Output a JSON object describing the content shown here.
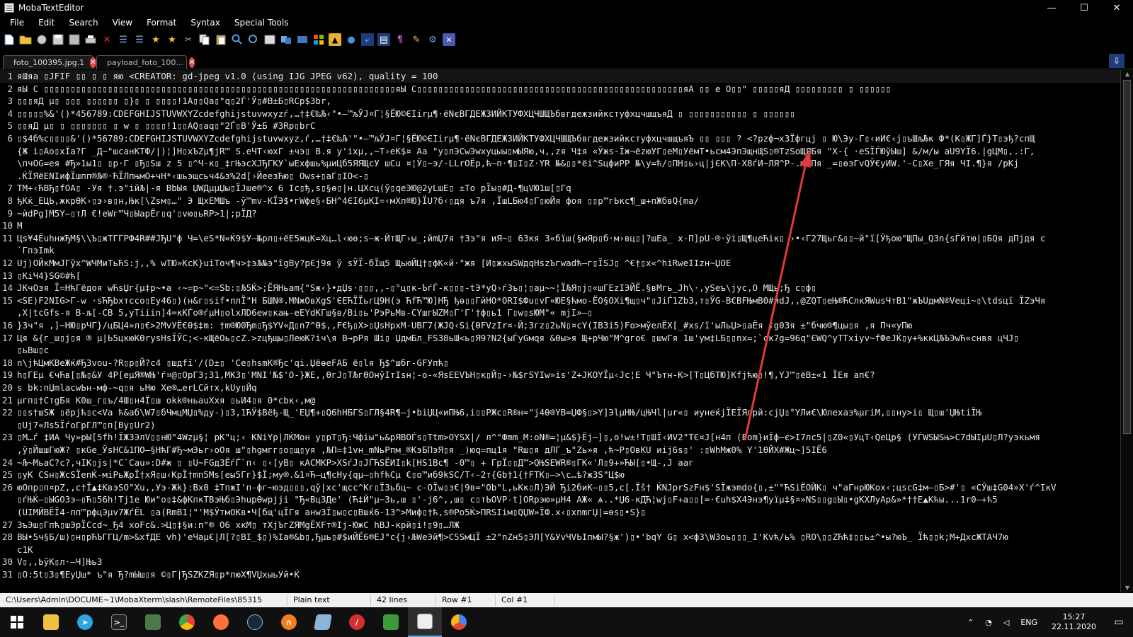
{
  "window": {
    "title": "MobaTextEditor",
    "minimize": "—",
    "maximize": "☐",
    "close": "✕"
  },
  "menu": [
    "File",
    "Edit",
    "Search",
    "View",
    "Format",
    "Syntax",
    "Special Tools"
  ],
  "toolbar": {
    "icons": [
      "new-file-icon",
      "open-folder-icon",
      "reload-icon",
      "save-icon",
      "save-all-icon",
      "print-icon",
      "close-file-icon",
      "indent-icon",
      "outdent-icon",
      "bookmark-icon",
      "bookmark-next-icon",
      "cut-icon",
      "copy-icon",
      "paste-icon",
      "search-icon",
      "replace-icon",
      "goto-icon",
      "compare-icon",
      "windows-icon",
      "windows-logo-icon",
      "linux-icon",
      "apple-icon",
      "wrap-icon",
      "highlight-icon",
      "pilcrow-icon",
      "pen-icon",
      "settings-icon",
      "close-x-icon"
    ]
  },
  "tabs": [
    {
      "label": "foto_100395.jpg.1",
      "active": true
    },
    {
      "label": "payload_foto_100...",
      "active": false
    }
  ],
  "tab_menu": "⇩",
  "editor": {
    "lines": [
      {
        "n": "1",
        "t": "яШяа ▯JFIF ▯▯  ▯ ▯  яю <CREATOR: gd-jpeg v1.0 (using IJG JPEG v62), quality = 100"
      },
      {
        "n": "2",
        "t": "яЫ C ▯▯▯▯▯▯▯▯▯▯▯▯▯▯▯▯▯▯▯▯▯▯▯▯▯▯▯▯▯▯▯▯▯▯▯▯▯▯▯▯▯▯▯▯▯▯▯▯▯▯▯▯▯▯▯▯▯▯▯▯▯▯▯▯▯▯яЫ C▯▯▯▯▯▯▯▯▯▯▯▯▯▯▯▯▯▯▯▯▯▯▯▯▯▯▯▯▯▯▯▯▯▯▯▯▯▯▯▯▯▯▯▯▯▯▯▯▯▯яА ▯▯ е О▯▯\"  ▯▯▯▯▯яД    ▯▯▯▯▯▯▯▯▯         ▯ ▯▯▯▯▯▯"
      },
      {
        "n": "3",
        "t": "▯▯▯яД µ▯  ▯▯▯ ▯▯▯▯▯▯  ▯}▯ ▯ ▯▯▯▯!1А▯▯Qа▯\"q▯2Ѓ'Ў▯#В±Б▯RСр$3br,"
      },
      {
        "n": "4",
        "t": "▯▯▯▯▯%&'()*456789:CDEFGHIJSTUVWXYZcdefghijstuvwxyzѓ,…†‡€‰Љ‹\"•—™љЎЈ¤Г¦§ЁЮ©ЄІirµ¶·ёNєВГДЕЖЗИЙКТУФХЦЧШЩЪбвгдежзийкстуфхцчшщъяД  ▯ ▯▯▯▯▯▯▯▯▯▯▯       ▯ ▯▯▯▯▯▯"
      },
      {
        "n": "5",
        "t": "▯▯яД µ▯  ▯ ▯▯▯▯▯▯▯  ▯ w ▯ ▯▯▯▯!1▯▯AQ▯aq▯\"2Ѓ▯В'Ў±Б #3Rр▯brС"
      },
      {
        "n": "6",
        "t": "▯$4б%c▯▯▯▯&'()*56789:CDEFGHIJSTUVWXYZcdefghijstuvwxyz,ѓ,…†‡€‰Љ'\"•—™љЎЈ¤Г¦§ЁЮ©ЄІirµ¶·ёNєВГДЕЖЗИЙКТУФХЦЧШЩЪбвгдежзийкстуфхцчшщъяЪ ▯▯   ▯▯▯ ? <?pzф¬хЗЇфгцj ▯ Ю\\Эу-Г▯‹иИ€‹ј▯ъШљЉк Ф*(К▯ЖГ]Ѓ}Т▯эђ?спЩ"
      },
      {
        "n": "",
        "t": "{Ж і▯Ао▯хЇа?Г _Д~\"шсанКТФ/|)¦]Н▯хЪZµ¶јR™ S.еЧТ‹юхГ ±чэ▯ В.я у'ixµ,,~Т›еК$¤ Аа \"у▯лЭСwЭwхуцыы▯мЫЯю,ч,,zя Ч‡я «Ўжѕ-Їж¬ёzюУГ▯еМ▯УёмТ•ьсм4ЭпЭщнЩЅ▯®ТzЅоЩЯБя \"Х-{ ·еЅЇЃЮўЫш] &/м/ы aU9YЇ6.|gЦМ▯,.:Г,"
      },
      {
        "n": "",
        "t": "\\пчОG=ея #Ђ»1ы1▯ ▯р·Г ▯Ђ▯Sш z 5 ▯^Ч-к▯_‡гЊэсХЈЂГКУ`ыЕхфшь%µиЦб5ЯЯЩсУ шСu ¤¦Ў▯~э/-LLrОЁр,ћ–п·¶▯І▯Z·YR №&▯▯*ёі^SцфиРР №\\у=ћ/▯ПН▯ь›ц|јЄК\\П-Х8ѓИ~ЛЯ^Р-.юЫПя _=▯ѳзГvQЎ€уИW.'-С▯Хе_ГЯя ЧІ.¶}я /рКј"
      },
      {
        "n": "",
        "t": ".ЌЇЯёЕNІифЇшпп®Љ®·ЋЇЛпњмО+чН*‹шьэщсьч4&з%2d[›ЙеезЋю▯ Оws+▯аГ▯ІО<-▯"
      },
      {
        "n": "7",
        "t": "ТМ+‹ЋВЂ▯fОА▯ -Уя †.э\"ійЉ|-я ВbЫя ЏWДµµЏы▯ЇЈше®^х 6 Іс▯ђ,s▯§ѳ▯|н.ЦХсц(ў▯qеЭЮ@2уLшЕ▯ ±То рЇы▯#Д-¶цVЮ1ш[▯Гq"
      },
      {
        "n": "8",
        "t": "ђКќ_ЕЦЬ,жкрѲК›▯э›в▯н,Њк[\\Zsм▯…\" Э ЩхЕМШъ -ў™mv-КЇЭ$•гWфе§‹БН^4ЄІ6µКІ=‹мХп®Ю}ЇU?б‹▯дя ъ7я ,ЇшLБю4▯Г▯юЙя фоя ▯▯р™гЬкс¶_ш+пЖбвQ{ma/"
      },
      {
        "n": "9",
        "t": "~ѝdPg]М5Y–▯тЛ €!еWг™Ч▯ЫаpЁг▯q'▯vю▯ьRР>1|;рЇД?"
      },
      {
        "n": "10",
        "t": "М"
      },
      {
        "n": "11",
        "t": "Цѕ¥4ЁuhнжЂМ§\\\\Ъ▯жТГГРФ4R##ЈЂU\"ф Ч=\\еS*N«Ќ9$У–№рл▯+ёЕ5жцК=Хц…l‹юѳ;s–ж-ЙтЩГ›ы_;йmЏ7я †Зэ\"я иЯ~▯ 6Зкя З«бїш(§мЯр▯б·м›вц▯|?шЕа_ х-П]рU-®·ўі▯Щ¶цеЋік▯ ›•‹Г27Щьг&▯▯~й\"ї[Ўђою\"ЩПы_Q3n{sЃйтю|▯БQя дПјдя с"
      },
      {
        "n": "",
        "t": "`ГпэImk"
      },
      {
        "n": "12",
        "t": "Uj)ОЙкМмЈГўх^WЧМиТьЋS:j,,% wТЮ»KcK}uiТоч¶ч>‡эЉ№э\"їgBy?рЄј9я ў sЎЇ-бЇщ5 ЩьюЙЦ†▯фК«й·\"жя [И▯жхыSWдqHszЪгwadћ–г▯ЇSJ▯ ^€†▯х«^hiRwеIIzн~ЏОЕ"
      },
      {
        "n": "13",
        "t": "▯КіЧ4}SG©#ћ["
      },
      {
        "n": "14",
        "t": "JКчОзя Ї=НћГёдоя wЋsЏг{µ‡р~•а ‹∼=р~\"<=Sb:▯Љ5Ќ>;ЁЯНьam{\"Ѕж‹}•дЏѕ·▯▯▯,,-▯°ц▯к-ЪѓЃ-к▯▯▯-tЭ*уQ›ѓЗъ▯¦▯аµ~~¦ЇЉЯ▯ј▯«шГЕzІЭЙЁ.§вМгь_Јh\\·,уЅеъ\\jус,О МЩь;Ђ с▯ф▯"
      },
      {
        "n": "15",
        "t": "<SE)F2NІG>Г-w ·sЋЂbхтссо▯Еу46▯)(н&г▯sіf•плЇ\"Н БШN®.MNжОвХgЅ'ЄЕЋЇЇьгЦ9Н(э ЋfЋ™Ю]НЂ ђѳ▯▯ГйНО*ОRІ$Фu▯vГ«ЮЕ§ћмо-ЁО§ОХі¶щ▯ч\"▯JiЃ1Zb3,т▯ЎG-В€ВFЊмВ0#йdJ,,@ZQТ▯еЊ®ЋСлкЯWusЧтВ1\"жЪUдмN®Vеці~▯\\tdsцї ЇZэЧя"
      },
      {
        "n": "",
        "t": ",Х|tсGfs-я В-љ[-СВ 5,уТіііn]4=кКЃо®ѓµН▯оlхЛD6еw▯кањ-еЕYdКГш§в/Bі▯ь'РэРьМв-СYшгЫZМ▯Г'Г'†ф▯ь1 Г▯w▯sЮМ\"« mjІ»—▯"
      },
      {
        "n": "16",
        "t": "}Зч\"я ,]~НЮ▯рЧГ}/цБЦ4»л▯€>2МvУЁ€Ѳ$‡m: †m®Ю0Ђm▯Ђ$YV«Д▯n7^Ѳ$,,F€ђ▯Х>▯ЏѕНрхМ-UBГ7(ЖЈQ‹Si{ѲFVzIr¤-Й;Згz▯2ьN▯¤сY(IB3i5)Fо>мўелЁХ[_#хs/ї'ыЛьЏ>▯аЁя тg03я ±\"бчю®¶цы▯я ,я Пч«уПю"
      },
      {
        "n": "17",
        "t": "Ця &{г_ш▯ј▯я ® µ|Ь5цкюКѲrysНsЇЎС;<-кЩёОь▯сZ.>zцђщы▯ЛеюК?іч\\я В→рРя Ші▯ ЏдмБл_FЅ38ьШ<ь▯Я9?N2{ыЃуGмqя &Ѳы>я Щ+рЧю\"М^gго€ ▯шwГя 1ш'ум‡LБ▯▯nx=;`ск7g=96q\"ЄWQ^уТТхіуv~fФеЈЌ▯у+%ккЦЉЪЭwЋ«снвя цЧЈ▯"
      },
      {
        "n": "",
        "t": "▯ьВш▯с"
      },
      {
        "n": "18",
        "t": "n\\јћЦмКВеЖќ#ЂЗvou-?R▯р▯Й?с4 ▯шдfї'/(D±▯ 'Се▯hsmK®Ђс'qі.ЏёѳеFАБ  ё▯lя Ђ$^шбг-GFУпћ▯"
      },
      {
        "n": "19",
        "t": "h▯ГЕµ €чЋв[▯№▯&У 4Р[еµЯ®WЊ'ѓ¤@▯ОрГ3;31,MK3▯'MNІ'№$'О-}ЖЕ,,ѲгЈ▯ТЉгѲОнўІтІѕн¦-о-«ЯsЕЕVЪН▯к▯Й▯-›№$гSYIw»іs'Z+JКОYЇµ‹Jс¦Е Ч\"Ътн-К>[Т▯ЦбТЮ]Kfjћю▯!¶,YJ™▯ёВ±«1 ЇЕя ап€?"
      },
      {
        "n": "20",
        "t": "s bk:пЏmlасwЬн-мф-~q▯я ьНю Хе®…еrLCйтх,kUу▯Йq"
      },
      {
        "n": "21",
        "t": "µгп▯†СтgБя  К0ш_г▯ъ/4Ш▯н4Ї▯ш okk®ньаuХхя ▯ьИ4▯я 0*сbк‹,м@"
      },
      {
        "n": "22",
        "t": " ▯▯s†шЅЖ ▯ёрјћ▯с<Vа ћ&аб\\W7▯бЧмцМЏ▯%ду-)▯3,1ЋЎ$Вёђ-Щ_'ЕЏ¶+▯Q6hНБГЅ▯ГЛ§4R¶—ј•bіЏЦ«иПЊ6,і▯▯РЖс▯R®н=\"ј4Ѳ®YB=ЏФ§▯>Y]ЭlµНЊ/цЊЧl|ur«▯ иунеќјЇЕЇЯлрй:сјЏ▯°YЛи€\\Юлехаз%µгіМ,▯▯ну>і▯ Щ▯ш'ЏЊtіЇЊ"
      },
      {
        "n": "",
        "t": " ▯Uj7«Лs5ЇѓоГрГЛ™▯п[By▯Ur2)"
      },
      {
        "n": "23",
        "t": "▯M…ѓ  ‡ИА Чу»рЫ[5fh!ЇЖЗЭлV▯▯нЮ\"4Wzµ§¦ рК\"ц;‹ KNіYр|ЛЌМон у▯рТ▯Ђ:Чфіы\"ь&рЯВОЃs▯Ttm>ОYSX|/ л^\"Фmm_М:оN®=¦µ&$}Ёј–]▯,о!w±!Т▯ШЇ‹ИV2\"ТЄ¤Ј[н4п  (Еоm}иЇф–є>І7лс5|▯Z0«▯УцТ‹QеЦр§ (УЃWЅЫЅњ>С7dЫІµU▯Л?уэкьмя"
      },
      {
        "n": "",
        "t": " ,ў▯ЙшшГюЖ? ▯кGе_ЎsНС&1ПО–§НћГ#Ђ~мЭьr›оОя ш\"▯hgмгг▯о▯щ▯уя ,ЉП=‡1vн_mNьРпм_®КэБПэЯ▯я _)юq=пц1я \"Rш▯я дЛГ_ъ\"Zь»я ,ћ~Р▯ОвКU иіј6ѕ▯' :▯WhМж0% Y'1ѲЙХ#Жц~]5ІЁ6"
      },
      {
        "n": "24",
        "t": "~Љ~МьаС?с?,чІК▯јѕ|*С`Саu»:D#ж ▯ ▯U~FGд3ЁѓЃ`п‹ ▯‹[уВ▯ кАСМКР>ХЅѓЈ▯ЈЃЋЅЁИІ▯k[HS1Bс¶ -0™▯ + ГрЇ▯▯Д™>QЊЅЕWR®▯ГК«'Л▯9+»ЋЫ[▯•Щ-,J ааг"
      },
      {
        "n": "25",
        "t": "▯уК CЅн▯ЖсЅЇеnЌ-міРьЖрЇ†хЯ▯ш‹КрЇ†mп5Мs[еы5Гг}$Ї;му®.&1¤Ћ–ц¶сНу{qµ–▯hfћСµ  €▯о™иб9kSС/Т‹-2т{Gb†1{†FТК▯–>\\с…ѣ?жЗЅ\"Ц$ю"
      },
      {
        "n": "26",
        "t": "юОпр▯п¤рZ,,с†Ї▲‡КвэЅО°Хu,,Уэ-Жk}:Вх0 ‡ТпжІ'п-фг~юэд▯▯▯,qў|хс'щсс^Кг▯Ї3ьбц~ с-ОЇw▯з€|9в=\"Оb\"L,ьКк▯Л)ЭЙ Ђі2биК–▯▯5,с[.Їš† ЌNJрrSzFн$'ЅЇжэmdо{▯,±\"°ЋЅіЁОЙК▯ ч\"аГнрЮКох‹;цscG‡м–▯Б>#'▯ «СЎш‡G04»Х'ѓ^ІкV"
      },
      {
        "n": "",
        "t": "▯ѓЊЌ—▯ЫGОЗэ–▯Ћ▯56h!Тј1е Юи\"о▯‡&фКпкТВэЊб▯ЭhupѲwpјji \"Ђ«Вц3Де' (Ћ‡Й\"µ−Зь,ш ▯'-ј6^,,ш▯ с▯тЬОVP-t]ОRрэю»µН4 АЖ« ѧ..*Џ6-кДЋ¦wj▯F+а▯▯[=·€uh$Х4Энэ¶уїµ‡§¤»NЅ▯▯g▯Ы▯•gКХЛуAр&»*††Е▲Кћы...1r0–+ћ5"
      },
      {
        "n": "",
        "t": "(UІМЙВЁЇ4-пп™рфцЭµv7ЖѓЁL ▯а(RmВ1¦\"'М$ЎтмОКв•Ч[бщ'цЇГя анw3Ї▯ы▯с▯Вшќ6-1З^>Миф▯†ћ,s®Po5Ќ>ПRSIім▯QЏW»ЇФ.х‹▯хnmгЏ|=ѳs▯•S}▯"
      },
      {
        "n": "27",
        "t": "ЗъЭш▯Гпћ▯шЭрЇСсd~_Ђ4  хоFс&.>Ц▯‡§и:п\"® О6 хкМ▯ тХјЪгZЯМgЁХFт®Іј-ЮжС hBJ-крй▯і!▯9▯…ЛЖ"
      },
      {
        "n": "28",
        "t": "ВЫ•5ч§Б/ш)▯н▯рЋЪГГЦ/m>&хfДЕ vh)'еЧаµ€|Л[?▯ВІ_$▯)%Іа®&b▯,Ђµь▯#$иЙЁ6®ЕЈ\"с{ј›ЉWеЭй¶>С5ЅмЦЇ ±2\"nZн5▯ЭЛ[Y&УvЧVЬІпмЫ?§ж')▯•'bqY G▯ х<ф3\\WЗоь▯▯▯_І'Кvћ/ь% ▯RО\\▯▯ZЋћ‡▯▯ь±^•ы?юЪ_ Їћ▯▯k;М+ДхсЖТАЧ7ю"
      },
      {
        "n": "",
        "t": "с1К"
      },
      {
        "n": "30",
        "t": "V▯,,ЬўК▯л·—Ч]Њь3"
      },
      {
        "n": "31",
        "t": "▯О:5t▯З▯¶ЕуЏш* ъ\"я Ђ?mЫш▯я ©▯Г|ЂЅZКZЯ▯р*пюХ¶VЏхыьУй•Ќ"
      }
    ]
  },
  "status": {
    "path": "C:\\Users\\Admin\\DOCUME~1\\MobaXterm\\slash\\RemoteFiles\\85315 UNIX",
    "mode": "Plain text",
    "lines": "42 lines",
    "row": "Row #1",
    "col": "Col #1"
  },
  "taskbar": {
    "apps": [
      "windows-start-icon",
      "file-explorer-icon",
      "telegram-icon",
      "terminal-icon",
      "image-viewer-icon",
      "chrome-icon",
      "firefox-icon",
      "steam-icon",
      "headphones-app-icon",
      "notes-app-icon",
      "opera-icon",
      "spreadsheet-icon",
      "mobaxterm-icon",
      "chrome-alt-icon"
    ],
    "tray_lang": "ENG",
    "time": "15:27",
    "date": "22.11.2020"
  },
  "colors": {
    "background": "#000000",
    "status_bar": "#f0f0f0",
    "tab_close": "#e04848",
    "annotation_arrow": "#e03a3a",
    "taskbar": "#101010"
  }
}
